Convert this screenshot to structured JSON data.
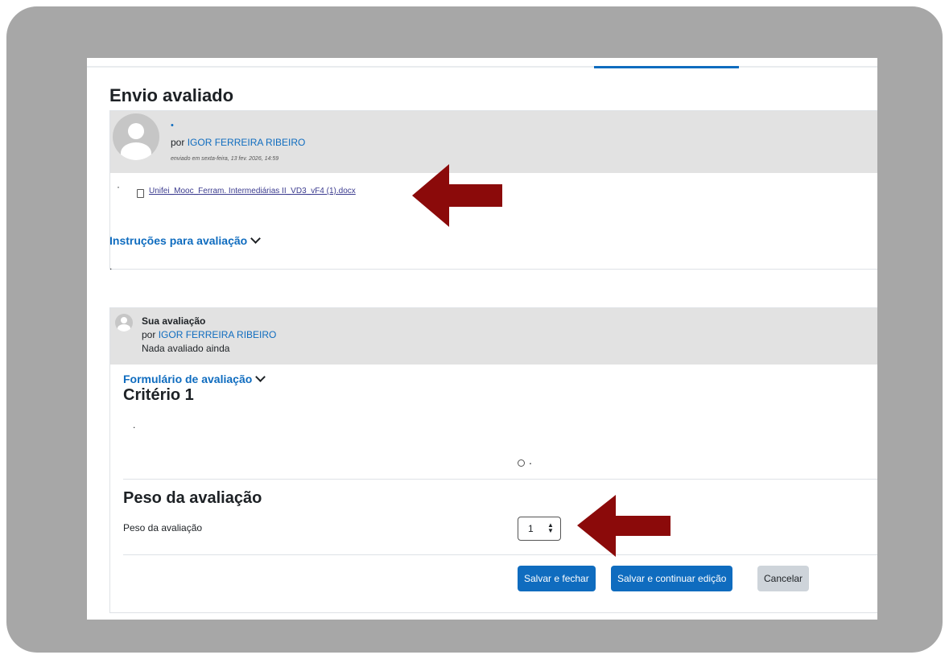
{
  "page": {
    "heading": "Envio avaliado"
  },
  "submission": {
    "dot": "•",
    "author_prefix": "por",
    "author_name": "IGOR FERREIRA RIBEIRO",
    "date": "enviado em sexta-feira, 13 fev. 2026, 14:59",
    "bullet": "·",
    "file_name": "Unifei_Mooc_Ferram. Intermediárias II_VD3_vF4 (1).docx",
    "file_icon": "document-icon"
  },
  "instructions": {
    "title": "Instruções para avaliação",
    "body": "."
  },
  "assessment": {
    "title": "Sua avaliação",
    "author_prefix": "por",
    "author_name": "IGOR FERREIRA RIBEIRO",
    "status": "Nada avaliado ainda"
  },
  "form": {
    "title": "Formulário de avaliação",
    "criterion_title": "Critério 1",
    "criterion_body": ".",
    "radio_label": ".",
    "weight_section_title": "Peso da avaliação",
    "weight_label": "Peso da avaliação",
    "weight_value": "1"
  },
  "buttons": {
    "save_close": "Salvar e fechar",
    "save_continue": "Salvar e continuar edição",
    "cancel": "Cancelar"
  },
  "annotations": {
    "arrow_color": "#8b0a0a"
  },
  "colors": {
    "primary": "#0f6cbf",
    "frame": "#a7a7a7",
    "header_bg": "#e2e2e2"
  }
}
